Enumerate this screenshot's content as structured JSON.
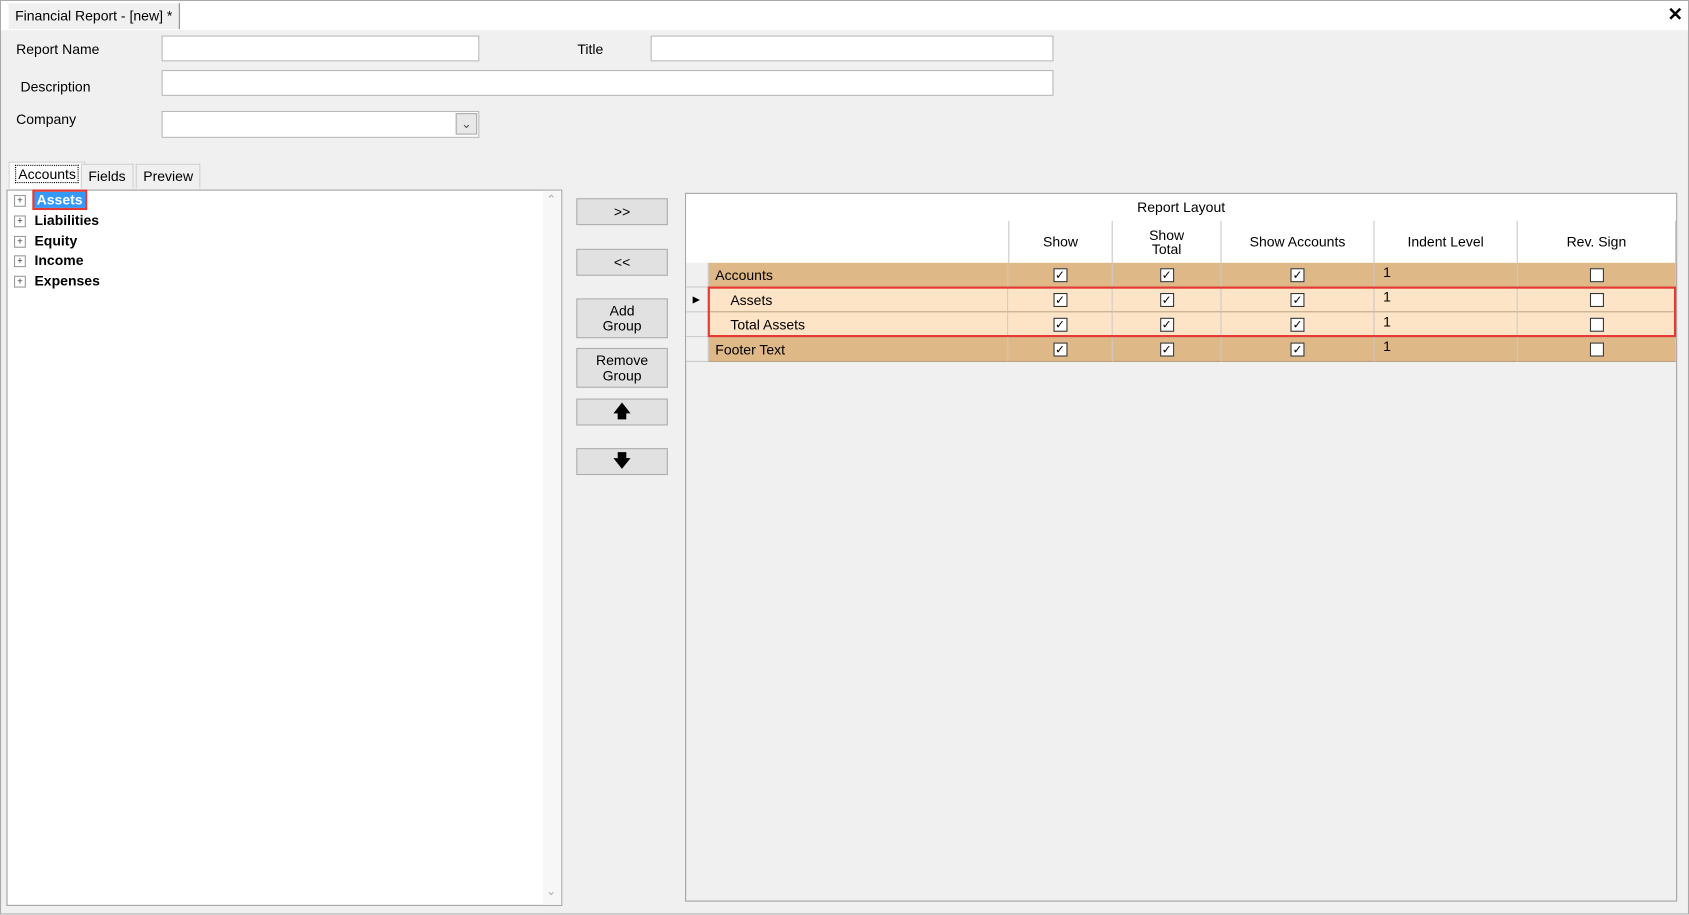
{
  "window": {
    "title": "Financial Report - [new] *",
    "close_icon": "close-icon"
  },
  "form": {
    "report_name": {
      "label": "Report Name",
      "value": ""
    },
    "title": {
      "label": "Title",
      "value": ""
    },
    "description": {
      "label": "Description",
      "value": ""
    },
    "company": {
      "label": "Company",
      "value": ""
    }
  },
  "tabs": [
    {
      "label": "Accounts",
      "active": true
    },
    {
      "label": "Fields"
    },
    {
      "label": "Preview"
    }
  ],
  "tree": {
    "items": [
      {
        "label": "Assets",
        "selected": true
      },
      {
        "label": "Liabilities"
      },
      {
        "label": "Equity"
      },
      {
        "label": "Income"
      },
      {
        "label": "Expenses"
      }
    ]
  },
  "buttons": {
    "add": ">>",
    "remove": "<<",
    "add_group": "Add Group",
    "remove_group": "Remove Group",
    "move_up": "move-up-icon",
    "move_down": "move-down-icon"
  },
  "grid": {
    "caption": "Report Layout",
    "columns": [
      "",
      "Show",
      "Show Total",
      "Show Accounts",
      "Indent Level",
      "Rev. Sign"
    ],
    "rows": [
      {
        "name": "Accounts",
        "show": true,
        "show_total": true,
        "show_accounts": true,
        "indent": "1",
        "rev_sign": false,
        "kind": "group"
      },
      {
        "name": "Assets",
        "show": true,
        "show_total": true,
        "show_accounts": true,
        "indent": "1",
        "rev_sign": false,
        "kind": "item",
        "current": true
      },
      {
        "name": "Total Assets",
        "show": true,
        "show_total": true,
        "show_accounts": true,
        "indent": "1",
        "rev_sign": false,
        "kind": "item"
      },
      {
        "name": "Footer Text",
        "show": true,
        "show_total": true,
        "show_accounts": true,
        "indent": "1",
        "rev_sign": false,
        "kind": "group"
      }
    ]
  },
  "colors": {
    "group_row": "#dfb887",
    "item_row": "#fde4c6",
    "selection": "#3399ff",
    "highlight": "#e53935"
  }
}
